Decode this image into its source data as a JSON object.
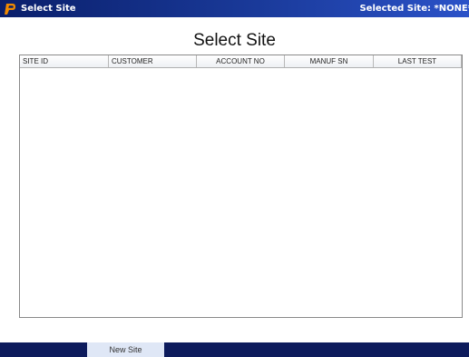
{
  "window": {
    "title": "Select Site",
    "selected_site": "Selected Site: *NONE*",
    "logo_icon": "app-logo-icon"
  },
  "page": {
    "heading": "Select Site"
  },
  "table": {
    "columns": [
      "SITE ID",
      "CUSTOMER",
      "ACCOUNT NO",
      "MANUF SN",
      "LAST TEST"
    ],
    "rows": []
  },
  "bottom_bar": {
    "new_site_label": "New Site"
  },
  "colors": {
    "titlebar_dark": "#0a1f6b",
    "titlebar_light": "#2b52c8",
    "bottom_bar": "#0d1b5c",
    "tab_bg": "#dfe7f6"
  }
}
